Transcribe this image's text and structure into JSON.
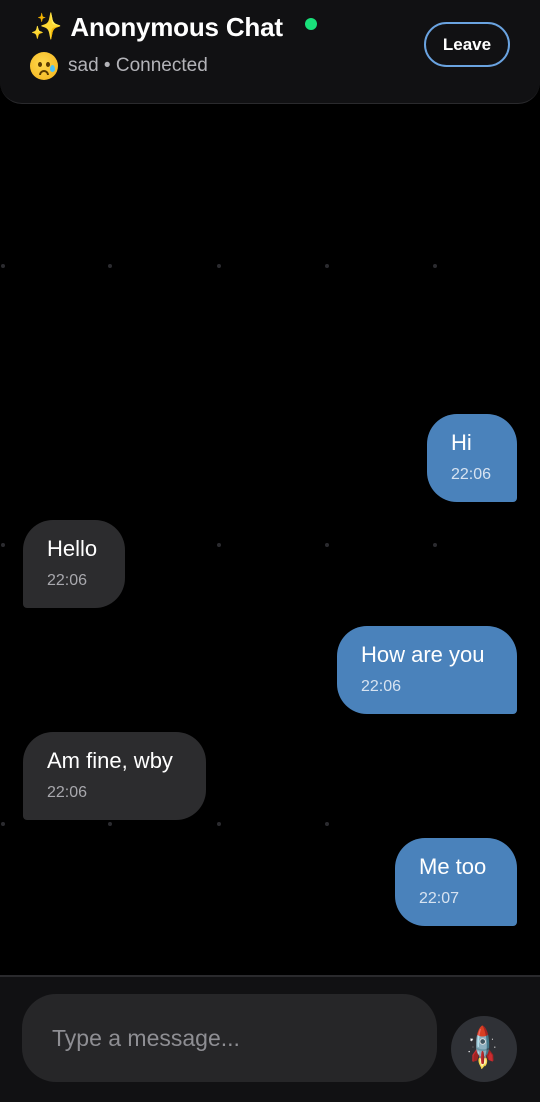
{
  "header": {
    "sparkle_glyph": "✨",
    "title": "Anonymous Chat",
    "mood_icon": "crying-face-icon",
    "mood_text": "sad",
    "separator": " • ",
    "connection_status": "Connected",
    "online_color": "#19e07a",
    "leave_label": "Leave"
  },
  "messages": [
    {
      "direction": "sent",
      "text": "Hi",
      "time": "22:06"
    },
    {
      "direction": "received",
      "text": "Hello",
      "time": "22:06"
    },
    {
      "direction": "sent",
      "text": "How are you",
      "time": "22:06"
    },
    {
      "direction": "received",
      "text": "Am fine, wby",
      "time": "22:06"
    },
    {
      "direction": "sent",
      "text": "Me too",
      "time": "22:07"
    }
  ],
  "composer": {
    "placeholder": "Type a message...",
    "value": "",
    "send_icon": "rocket-icon",
    "send_glyph": "🚀"
  },
  "colors": {
    "sent_bubble": "#4a82bb",
    "received_bubble": "#2c2c2e",
    "leave_border": "#6aa3e0"
  }
}
